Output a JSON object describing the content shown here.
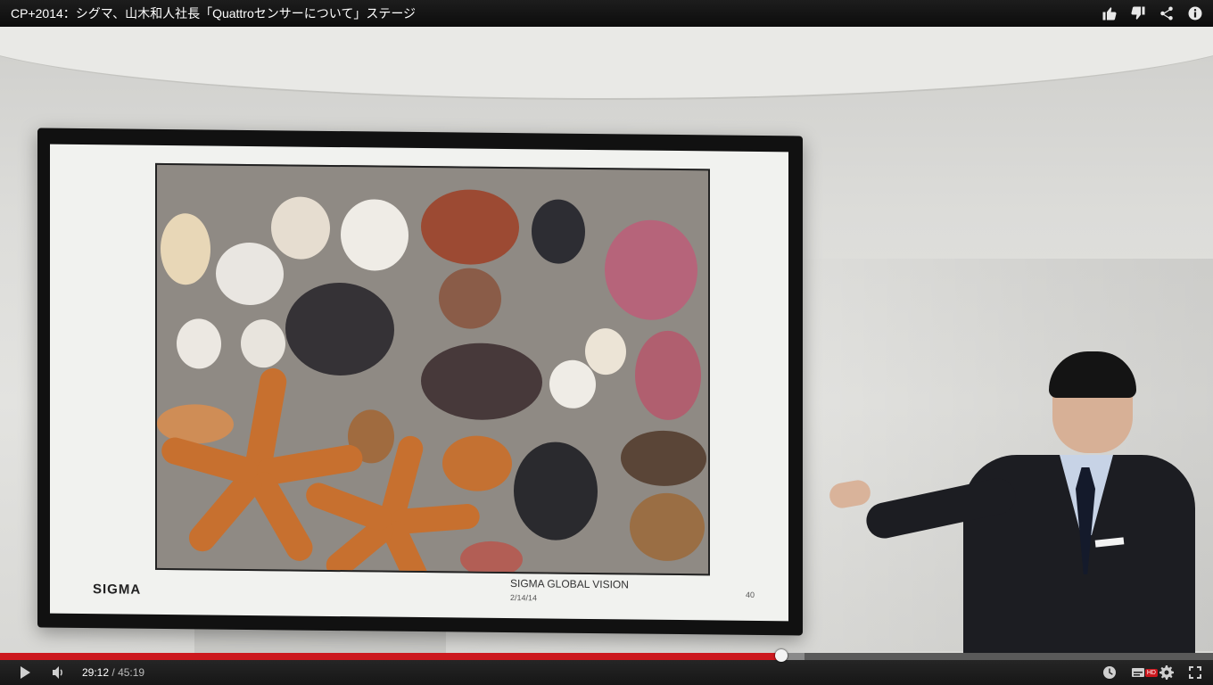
{
  "video": {
    "title": "CP+2014：シグマ、山木和人社長「Quattroセンサーについて」ステージ",
    "slide": {
      "logo": "SIGMA",
      "caption": "SIGMA GLOBAL VISION",
      "date": "2/14/14",
      "page": "40"
    }
  },
  "player": {
    "current_time": "29:12",
    "separator": "/",
    "duration": "45:19",
    "progress_fraction": 0.644,
    "buffered_fraction": 0.663,
    "hd_label": "HD"
  },
  "icons": {
    "like": "thumbs-up-icon",
    "dislike": "thumbs-down-icon",
    "share": "share-icon",
    "info": "info-icon",
    "play": "play-icon",
    "volume": "volume-icon",
    "watch_later": "clock-icon",
    "captions": "captions-icon",
    "settings": "gear-icon",
    "fullscreen": "fullscreen-icon"
  },
  "colors": {
    "progress_played": "#cc181e",
    "titlebar_bg": "#141414"
  }
}
